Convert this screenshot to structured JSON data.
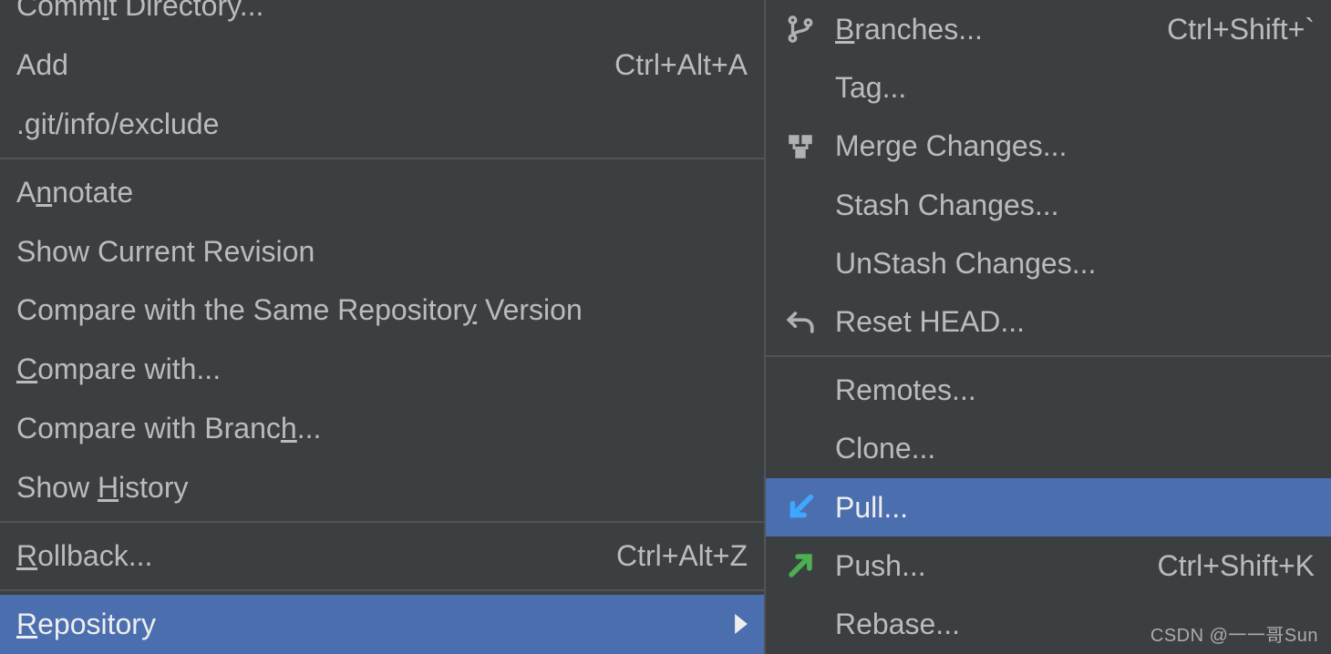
{
  "watermark": "CSDN @一一哥Sun",
  "left_menu": {
    "items": [
      {
        "id": "commit-dir",
        "pre": "Comm",
        "m": "i",
        "post": "t Directory...",
        "shortcut": ""
      },
      {
        "id": "add",
        "pre": "Add",
        "m": "",
        "post": "",
        "shortcut": "Ctrl+Alt+A"
      },
      {
        "id": "git-exclude",
        "pre": ".git/info/exclude",
        "m": "",
        "post": "",
        "shortcut": ""
      },
      {
        "sep": true
      },
      {
        "id": "annotate",
        "pre": "A",
        "m": "n",
        "post": "notate",
        "shortcut": ""
      },
      {
        "id": "show-rev",
        "pre": "Show Current Revision",
        "m": "",
        "post": "",
        "shortcut": ""
      },
      {
        "id": "compare-same",
        "pre": "Compare with the Same Repositor",
        "m": "y",
        "post": " Version",
        "shortcut": ""
      },
      {
        "id": "compare-with",
        "pre": "",
        "m": "C",
        "post": "ompare with...",
        "shortcut": ""
      },
      {
        "id": "compare-branch",
        "pre": "Compare with Branc",
        "m": "h",
        "post": "...",
        "shortcut": ""
      },
      {
        "id": "show-history",
        "pre": "Show ",
        "m": "H",
        "post": "istory",
        "shortcut": ""
      },
      {
        "sep": true
      },
      {
        "id": "rollback",
        "pre": "",
        "m": "R",
        "post": "ollback...",
        "shortcut": "Ctrl+Alt+Z"
      },
      {
        "sep": true
      },
      {
        "id": "repository",
        "pre": "",
        "m": "R",
        "post": "epository",
        "shortcut": "",
        "submenu": true,
        "selected": true
      }
    ]
  },
  "right_menu": {
    "items": [
      {
        "id": "branches",
        "pre": "",
        "m": "B",
        "post": "ranches...",
        "shortcut": "Ctrl+Shift+`",
        "icon": "branch"
      },
      {
        "id": "tag",
        "pre": "Tag...",
        "m": "",
        "post": "",
        "shortcut": ""
      },
      {
        "id": "merge",
        "pre": "Merge Changes...",
        "m": "",
        "post": "",
        "shortcut": "",
        "icon": "merge"
      },
      {
        "id": "stash",
        "pre": "Stash Changes...",
        "m": "",
        "post": "",
        "shortcut": ""
      },
      {
        "id": "unstash",
        "pre": "UnStash Changes...",
        "m": "",
        "post": "",
        "shortcut": ""
      },
      {
        "id": "reset-head",
        "pre": "Reset HEAD...",
        "m": "",
        "post": "",
        "shortcut": "",
        "icon": "undo"
      },
      {
        "sep": true
      },
      {
        "id": "remotes",
        "pre": "Remotes...",
        "m": "",
        "post": "",
        "shortcut": ""
      },
      {
        "id": "clone",
        "pre": "Clone...",
        "m": "",
        "post": "",
        "shortcut": ""
      },
      {
        "id": "pull",
        "pre": "Pull...",
        "m": "",
        "post": "",
        "shortcut": "",
        "icon": "pull",
        "selected": true
      },
      {
        "id": "push",
        "pre": "Push...",
        "m": "",
        "post": "",
        "shortcut": "Ctrl+Shift+K",
        "icon": "push"
      },
      {
        "id": "rebase",
        "pre": "Rebase...",
        "m": "",
        "post": "",
        "shortcut": ""
      }
    ]
  }
}
